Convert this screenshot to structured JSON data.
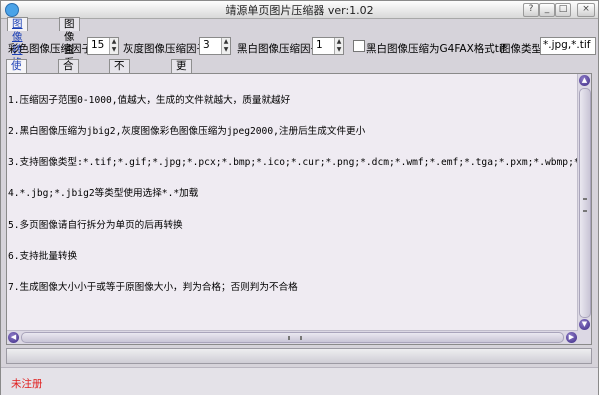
{
  "window": {
    "title": "靖源单页图片压缩器 ver:1.02"
  },
  "main_tabs": [
    {
      "label": "图像转换"
    },
    {
      "label": "图像查看"
    }
  ],
  "settings": {
    "color_factor_label": "彩色图像压缩因子",
    "color_factor_value": "15",
    "gray_factor_label": "灰度图像压缩因子",
    "gray_factor_value": "3",
    "bw_factor_label": "黑白图像压缩因子",
    "bw_factor_value": "1",
    "g4fax_label": "黑白图像压缩为G4FAX格式tif",
    "g4fax_checked": false,
    "image_type_label": "图像类型",
    "image_type_value": "*.jpg,*.tif"
  },
  "sub_tabs": [
    {
      "label": "使用说明"
    },
    {
      "label": "合格日志"
    },
    {
      "label": "不合格日志"
    },
    {
      "label": "更新日志"
    }
  ],
  "instructions": [
    "1.压缩因子范围0-1000,值越大，生成的文件就越大，质量就越好",
    "2.黑白图像压缩为jbig2,灰度图像彩色图像压缩为jpeg2000,注册后生成文件更小",
    "3.支持图像类型:*.tif;*.gif;*.jpg;*.pcx;*.bmp;*.ico;*.cur;*.png;*.dcm;*.wmf;*.emf;*.tga;*.pxm;*.wbmp;*.jp2;*.j2k;*.c",
    "4.*.jbg;*.jbig2等类型使用选择*.*加载",
    "5.多页图像请自行拆分为单页的后再转换",
    "6.支持批量转换",
    "7.生成图像大小小于或等于原图像大小，判为合格；否则判为不合格"
  ],
  "status": {
    "text": "未注册",
    "color": "#e02020"
  },
  "progress": {
    "value": 0
  },
  "accent_color": "#1a3fb5"
}
